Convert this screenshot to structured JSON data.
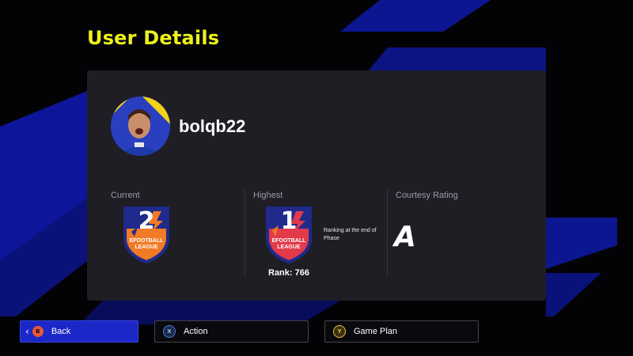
{
  "page": {
    "title": "User Details"
  },
  "profile": {
    "username": "bolqb22"
  },
  "ratings": {
    "current": {
      "label": "Current",
      "division": "2",
      "badge_caption": "EFOOTBALL\nLEAGUE"
    },
    "highest": {
      "label": "Highest",
      "division": "1",
      "badge_caption": "EFOOTBALL\nLEAGUE",
      "rank": "Rank: 766",
      "note": "Ranking at the end of Phase"
    },
    "courtesy": {
      "label": "Courtesy Rating",
      "grade": "A"
    }
  },
  "footer": {
    "back": {
      "key": "B",
      "label": "Back"
    },
    "action": {
      "key": "X",
      "label": "Action"
    },
    "game_plan": {
      "key": "Y",
      "label": "Game Plan"
    }
  },
  "colors": {
    "accent_yellow": "#ecf21a",
    "brand_blue": "#1c27c8",
    "badge_red": "#e23a4a",
    "badge_orange": "#f07a26",
    "badge_navy": "#1f2a8c",
    "key_b": "#e8563a",
    "key_x": "#4a7fd8",
    "key_y": "#e8c33a"
  },
  "icons": [
    "avatar-photo",
    "league-badge",
    "chevron-left-icon",
    "b-key-icon",
    "x-key-icon",
    "y-key-icon"
  ]
}
